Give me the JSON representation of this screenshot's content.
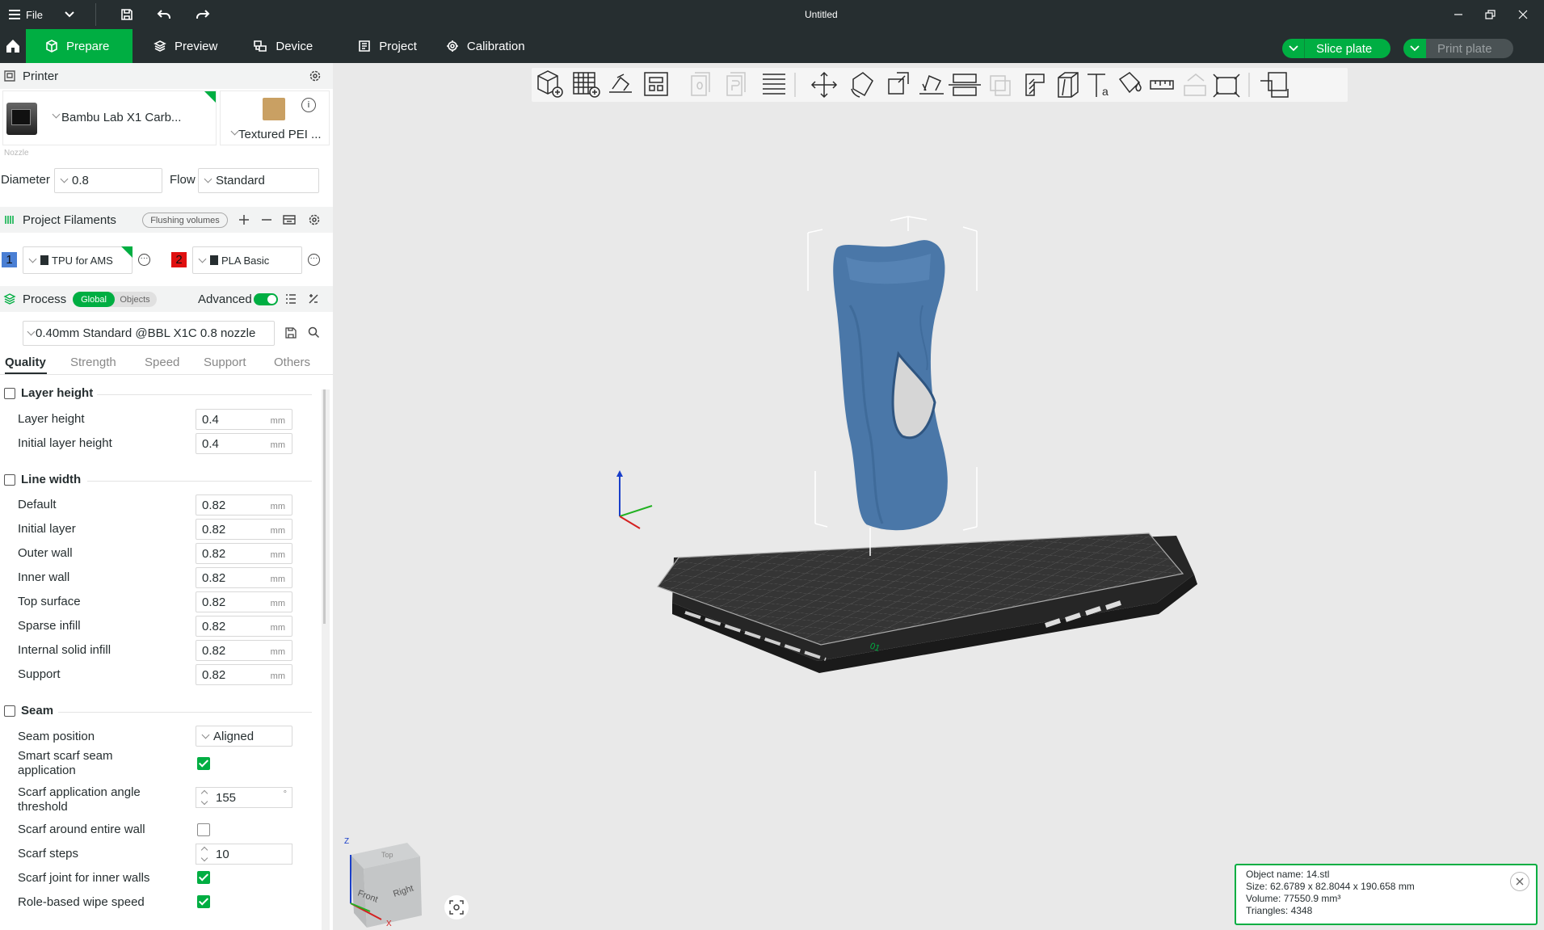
{
  "titlebar": {
    "menu_label": "File",
    "title": "Untitled"
  },
  "tabs": [
    {
      "label": "Prepare",
      "icon": "cube-icon",
      "active": true
    },
    {
      "label": "Preview",
      "icon": "layers-icon"
    },
    {
      "label": "Device",
      "icon": "device-icon"
    },
    {
      "label": "Project",
      "icon": "project-icon"
    },
    {
      "label": "Calibration",
      "icon": "calibration-icon"
    }
  ],
  "actions": {
    "slice": "Slice plate",
    "print": "Print plate"
  },
  "printer": {
    "header": "Printer",
    "name": "Bambu Lab X1 Carb...",
    "plate": "Textured PEI ...",
    "nozzle_label": "Nozzle",
    "diameter_label": "Diameter",
    "diameter": "0.8",
    "flow_label": "Flow",
    "flow": "Standard"
  },
  "filaments": {
    "header": "Project Filaments",
    "flushing_label": "Flushing volumes",
    "items": [
      {
        "index": "1",
        "name": "TPU for AMS",
        "color": "#4a7fd4"
      },
      {
        "index": "2",
        "name": "PLA Basic",
        "color": "#e01010"
      }
    ]
  },
  "process": {
    "header": "Process",
    "toggle_global": "Global",
    "toggle_objects": "Objects",
    "advanced_label": "Advanced",
    "preset": "0.40mm Standard @BBL X1C 0.8 nozzle",
    "tabs": [
      "Quality",
      "Strength",
      "Speed",
      "Support",
      "Others"
    ]
  },
  "quality": {
    "unit": "mm",
    "layer_height": {
      "title": "Layer height",
      "rows": [
        {
          "label": "Layer height",
          "value": "0.4"
        },
        {
          "label": "Initial layer height",
          "value": "0.4"
        }
      ]
    },
    "line_width": {
      "title": "Line width",
      "rows": [
        {
          "label": "Default",
          "value": "0.82"
        },
        {
          "label": "Initial layer",
          "value": "0.82"
        },
        {
          "label": "Outer wall",
          "value": "0.82"
        },
        {
          "label": "Inner wall",
          "value": "0.82"
        },
        {
          "label": "Top surface",
          "value": "0.82"
        },
        {
          "label": "Sparse infill",
          "value": "0.82"
        },
        {
          "label": "Internal solid infill",
          "value": "0.82"
        },
        {
          "label": "Support",
          "value": "0.82"
        }
      ]
    },
    "seam": {
      "title": "Seam",
      "position_label": "Seam position",
      "position_value": "Aligned",
      "smart_scarf_label": "Smart scarf seam application",
      "smart_scarf": true,
      "angle_label": "Scarf application angle threshold",
      "angle_value": "155",
      "angle_unit": "°",
      "entire_wall_label": "Scarf around entire wall",
      "entire_wall": false,
      "steps_label": "Scarf steps",
      "steps_value": "10",
      "inner_walls_label": "Scarf joint for inner walls",
      "inner_walls": true,
      "wipe_label": "Role-based wipe speed",
      "wipe": true
    }
  },
  "viewcube": {
    "front": "Front",
    "right": "Right",
    "top": "Top",
    "axis_z": "Z",
    "axis_x": "X"
  },
  "plate_number": "01",
  "object_info": {
    "name": "Object name: 14.stl",
    "size": "Size: 62.6789 x 82.8044 x 190.658 mm",
    "volume": "Volume: 77550.9 mm³",
    "triangles": "Triangles: 4348"
  },
  "colors": {
    "accent": "#00ae42",
    "titlebar": "#262e30",
    "model": "#4a77a8"
  }
}
